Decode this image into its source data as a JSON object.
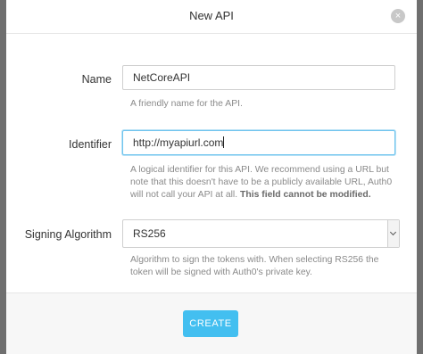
{
  "modal": {
    "title": "New API",
    "close_icon": "×"
  },
  "form": {
    "name": {
      "label": "Name",
      "value": "NetCoreAPI",
      "help": "A friendly name for the API."
    },
    "identifier": {
      "label": "Identifier",
      "value": "http://myapiurl.com",
      "help": "A logical identifier for this API. We recommend using a URL but note that this doesn't have to be a publicly available URL, Auth0 will not call your API at all.",
      "help_bold": "This field cannot be modified."
    },
    "signing_algorithm": {
      "label": "Signing Algorithm",
      "selected": "RS256",
      "help": "Algorithm to sign the tokens with. When selecting RS256 the token will be signed with Auth0's private key."
    }
  },
  "footer": {
    "create_label": "CREATE"
  },
  "colors": {
    "accent": "#43bff0",
    "focus_border": "#6fc4ee"
  }
}
